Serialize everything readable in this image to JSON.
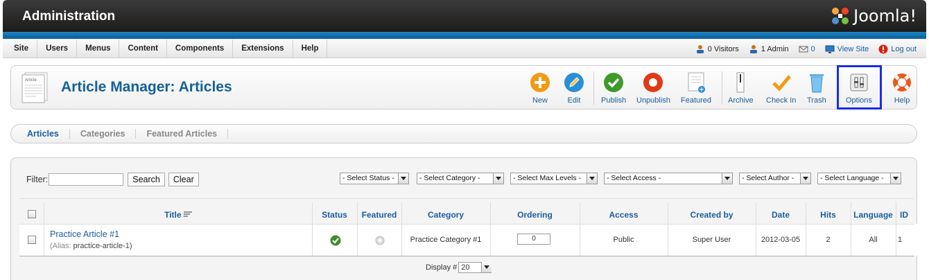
{
  "header": {
    "title": "Administration",
    "logo_text": "Joomla!"
  },
  "menu": [
    "Site",
    "Users",
    "Menus",
    "Content",
    "Components",
    "Extensions",
    "Help"
  ],
  "status": {
    "visitors": "0 Visitors",
    "admins": "1 Admin",
    "messages": "0",
    "view_site": "View Site",
    "logout": "Log out"
  },
  "page": {
    "title": "Article Manager: Articles",
    "icon_label": "Article"
  },
  "toolbar": [
    "New",
    "Edit",
    "Publish",
    "Unpublish",
    "Featured",
    "Archive",
    "Check In",
    "Trash",
    "Options",
    "Help"
  ],
  "subnav": [
    "Articles",
    "Categories",
    "Featured Articles"
  ],
  "filter": {
    "label": "Filter:",
    "value": "",
    "search": "Search",
    "clear": "Clear"
  },
  "selects": [
    "- Select Status -",
    "- Select Category -",
    "- Select Max Levels -",
    "- Select Access -",
    "- Select Author -",
    "- Select Language -"
  ],
  "table": {
    "headers": [
      "Title",
      "Status",
      "Featured",
      "Category",
      "Ordering",
      "Access",
      "Created by",
      "Date",
      "Hits",
      "Language",
      "ID"
    ],
    "rows": [
      {
        "title": "Practice Article #1",
        "alias_label": "(Alias:",
        "alias": "practice-article-1)",
        "category": "Practice Category #1",
        "ordering": "0",
        "access": "Public",
        "created_by": "Super User",
        "date": "2012-03-05",
        "hits": "2",
        "language": "All",
        "id": "1"
      }
    ]
  },
  "pagination": {
    "label": "Display #",
    "value": "20"
  },
  "colors": {
    "accent": "#1b5ea0",
    "title": "#146295",
    "highlight": "#1a2ee6"
  }
}
